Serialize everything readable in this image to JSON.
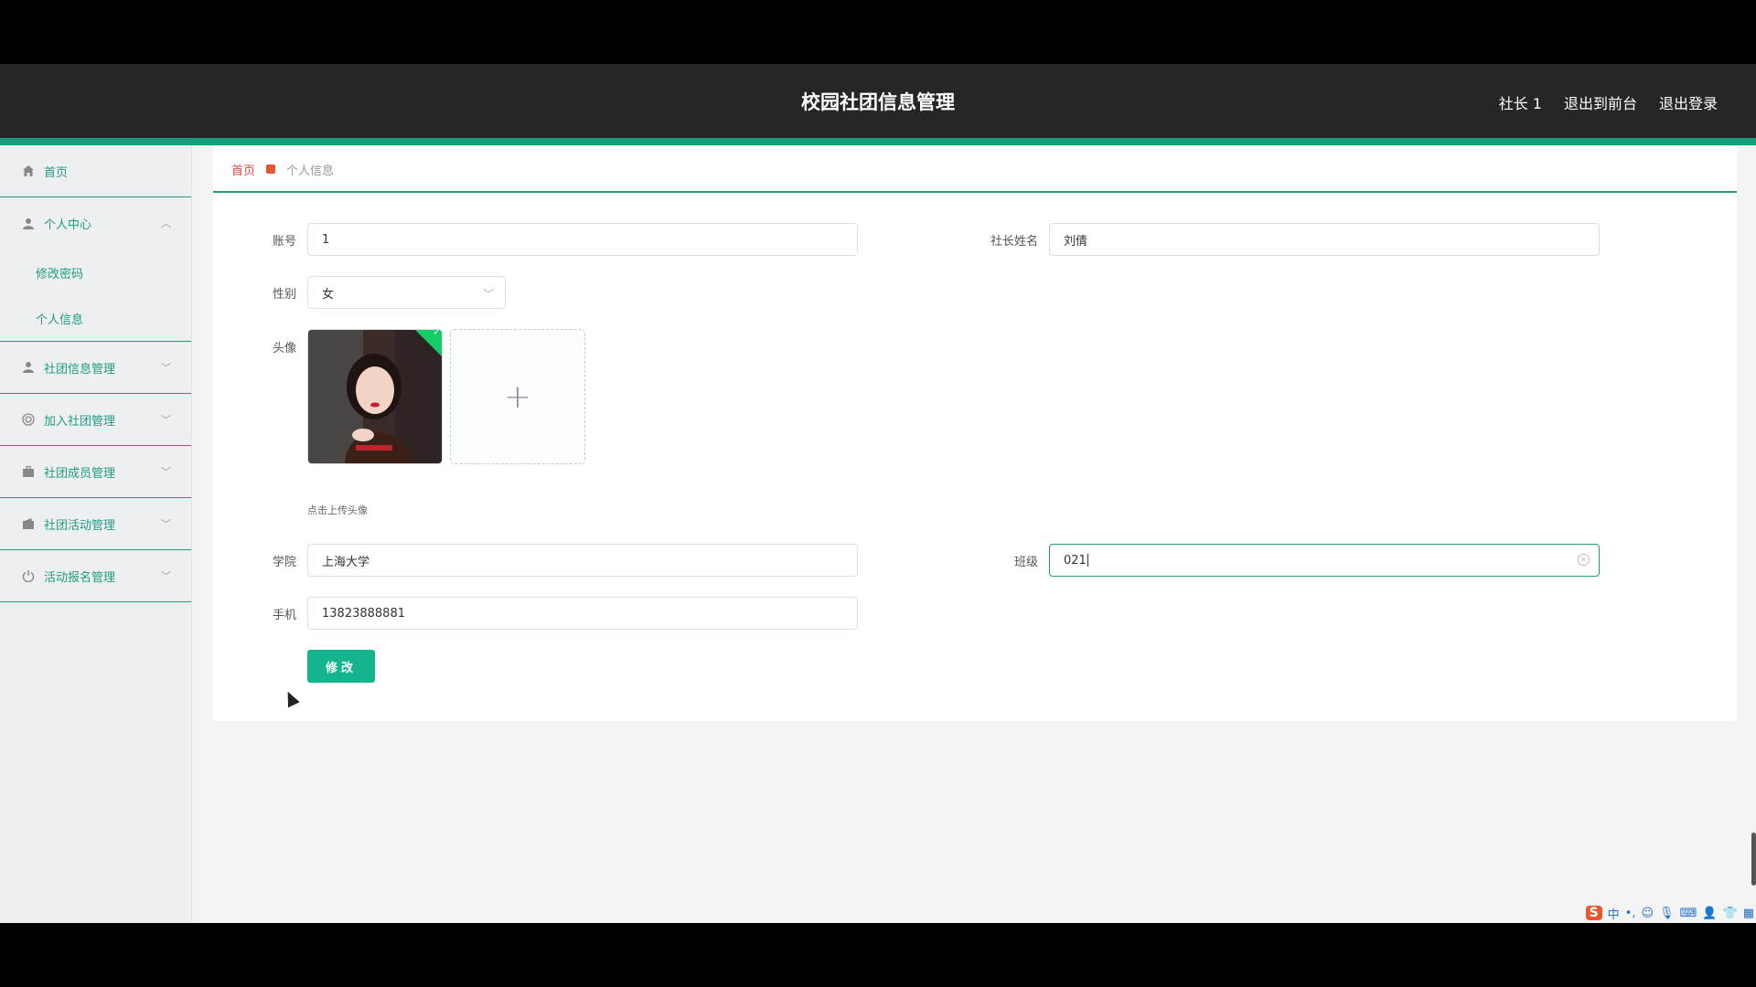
{
  "header": {
    "title": "校园社团信息管理",
    "user": "社长 1",
    "to_front": "退出到前台",
    "logout": "退出登录"
  },
  "sidebar": {
    "items": [
      {
        "label": "首页",
        "icon": "home-icon"
      },
      {
        "label": "个人中心",
        "icon": "user-icon",
        "expanded": true,
        "children": [
          {
            "label": "修改密码"
          },
          {
            "label": "个人信息"
          }
        ]
      },
      {
        "label": "社团信息管理",
        "icon": "user-icon"
      },
      {
        "label": "加入社团管理",
        "icon": "circle-icon"
      },
      {
        "label": "社团成员管理",
        "icon": "briefcase-icon"
      },
      {
        "label": "社团活动管理",
        "icon": "wallet-icon"
      },
      {
        "label": "活动报名管理",
        "icon": "power-icon"
      }
    ]
  },
  "breadcrumb": {
    "home": "首页",
    "current": "个人信息"
  },
  "form": {
    "account_label": "账号",
    "account_value": "1",
    "name_label": "社长姓名",
    "name_value": "刘倩",
    "gender_label": "性别",
    "gender_value": "女",
    "avatar_label": "头像",
    "avatar_tip": "点击上传头像",
    "school_label": "学院",
    "school_value": "上海大学",
    "class_label": "班级",
    "class_value": "021",
    "phone_label": "手机",
    "phone_value": "13823888881",
    "submit_label": "修改"
  },
  "ime": {
    "logo": "S",
    "mode": "中"
  },
  "colors": {
    "accent": "#1e9c82",
    "header_bg": "#262626",
    "button": "#13b48e",
    "breadcrumb_home": "#e64848"
  }
}
